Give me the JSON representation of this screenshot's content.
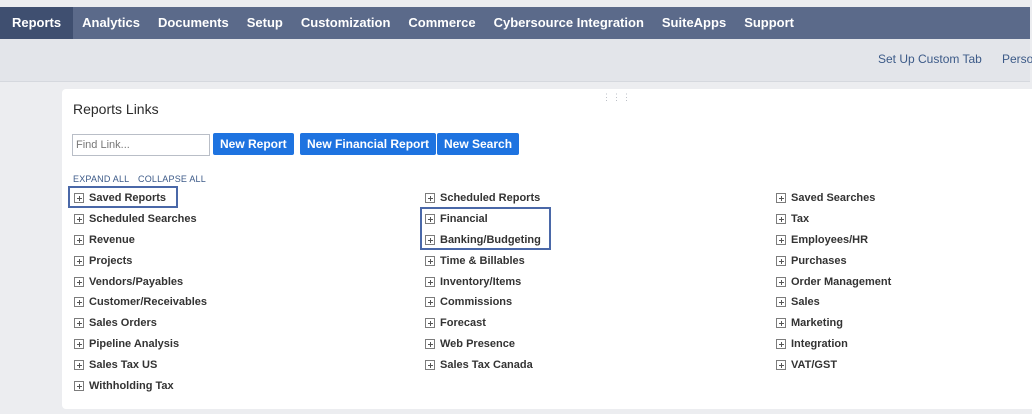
{
  "nav": {
    "items": [
      "Reports",
      "Analytics",
      "Documents",
      "Setup",
      "Customization",
      "Commerce",
      "Cybersource Integration",
      "SuiteApps",
      "Support"
    ]
  },
  "subbar": {
    "setup_custom_tab": "Set Up Custom Tab",
    "personalize": "Perso"
  },
  "panel": {
    "title": "Reports Links",
    "find_placeholder": "Find Link...",
    "buttons": [
      "New Report",
      "New Financial Report",
      "New Search"
    ],
    "expand_all": "EXPAND ALL",
    "collapse_all": "COLLAPSE ALL",
    "columns": [
      [
        "Saved Reports",
        "Scheduled Searches",
        "Revenue",
        "Projects",
        "Vendors/Payables",
        "Customer/Receivables",
        "Sales Orders",
        "Pipeline Analysis",
        "Sales Tax US",
        "Withholding Tax"
      ],
      [
        "Scheduled Reports",
        "Financial",
        "Banking/Budgeting",
        "Time & Billables",
        "Inventory/Items",
        "Commissions",
        "Forecast",
        "Web Presence",
        "Sales Tax Canada"
      ],
      [
        "Saved Searches",
        "Tax",
        "Employees/HR",
        "Purchases",
        "Order Management",
        "Sales",
        "Marketing",
        "Integration",
        "VAT/GST"
      ]
    ]
  },
  "colors": {
    "nav_bg": "#5b6a8a",
    "nav_active": "#3f4f70",
    "button_blue": "#1e73e0",
    "highlight_border": "#4a68a8"
  }
}
